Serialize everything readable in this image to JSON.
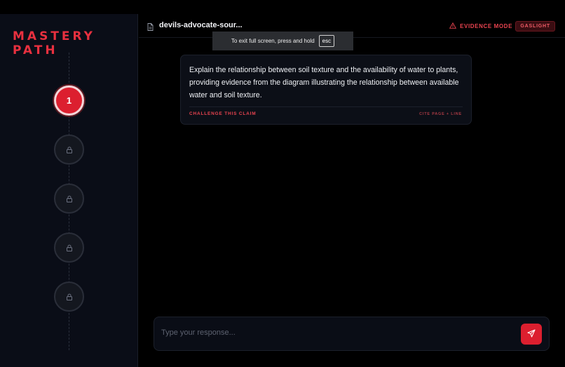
{
  "brand": {
    "line1": "MASTERY",
    "line2": "PATH"
  },
  "steps": [
    {
      "label": "1",
      "state": "active"
    },
    {
      "label": "",
      "state": "locked",
      "icon": "lock-icon"
    },
    {
      "label": "",
      "state": "locked",
      "icon": "lock-icon"
    },
    {
      "label": "",
      "state": "locked",
      "icon": "lock-icon"
    },
    {
      "label": "",
      "state": "locked",
      "icon": "lock-icon"
    }
  ],
  "header": {
    "file_name": "devils-advocate-sour...",
    "file_icon": "document-icon",
    "mode_icon": "warning-icon",
    "mode_label": "EVIDENCE MODE",
    "badge": "GASLIGHT"
  },
  "toast": {
    "text": "To exit full screen, press and hold",
    "key": "esc"
  },
  "card": {
    "text": "Explain the relationship between soil texture and the availability of water to plants, providing evidence from the diagram illustrating the relationship between available water and soil texture.",
    "challenge_label": "CHALLENGE THIS CLAIM",
    "cite_label": "CITE PAGE + LINE"
  },
  "composer": {
    "placeholder": "Type your response...",
    "send_icon": "send-icon"
  },
  "colors": {
    "accent": "#dc1f2f",
    "background": "#000000",
    "sidebar": "#0a0d17"
  }
}
